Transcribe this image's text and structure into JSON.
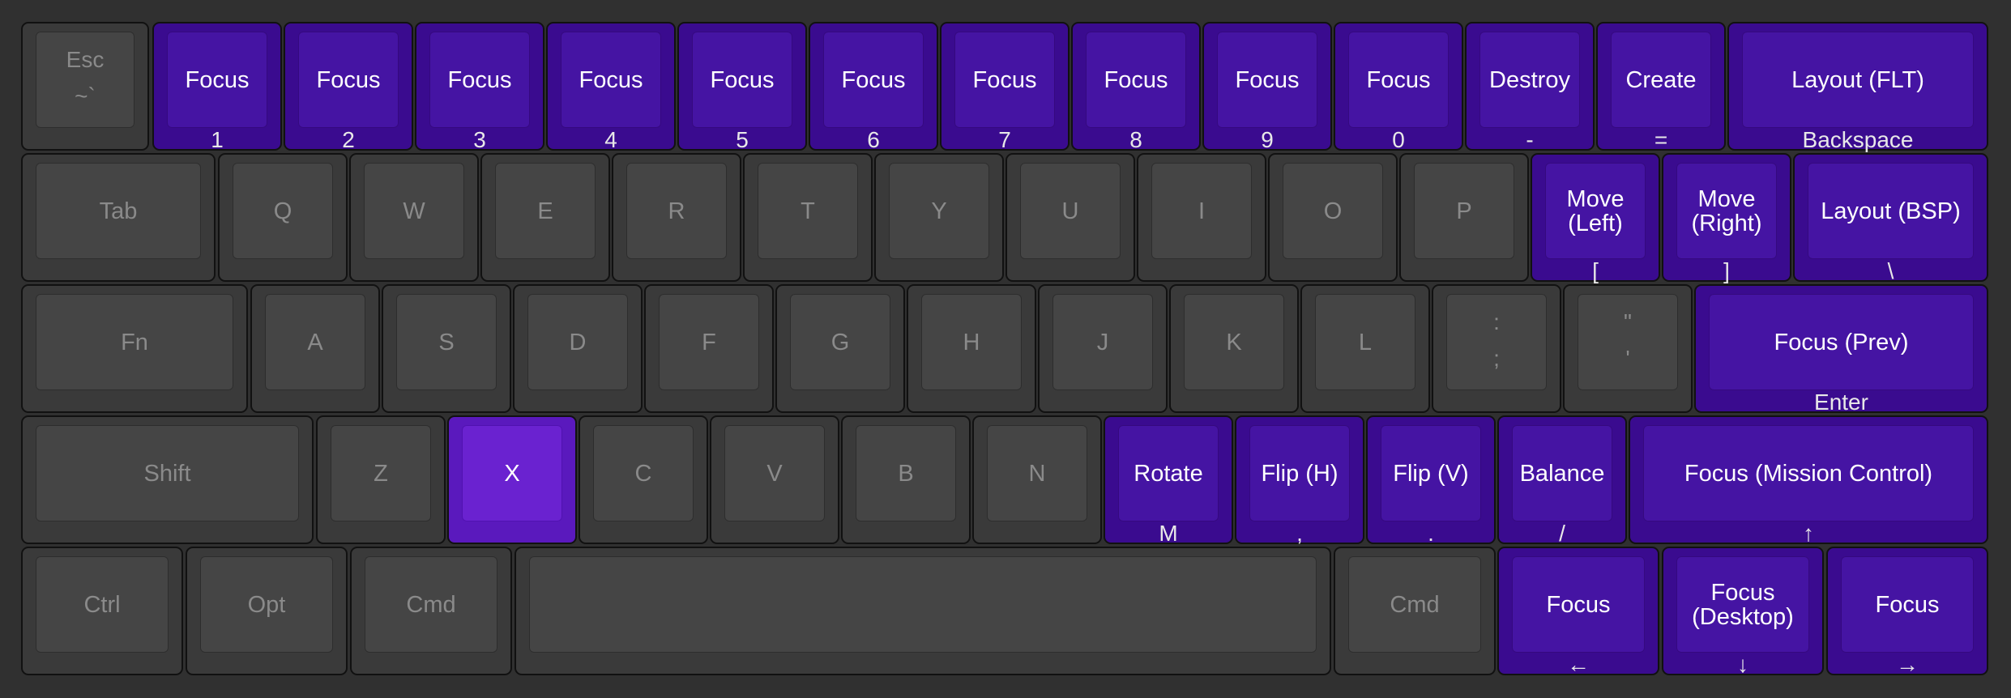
{
  "colors": {
    "background": "#303030",
    "key_inactive": "#3a3a3a",
    "key_active": "#3a0b8f",
    "key_pressed": "#5a19bd",
    "label_inactive": "#8a8a8a",
    "label_active": "#ffffff"
  },
  "keyboard": {
    "rows": [
      {
        "keys": [
          {
            "top": "Esc",
            "bottom": "~`",
            "active": false
          },
          {
            "label": "Focus",
            "sub": "1",
            "active": true
          },
          {
            "label": "Focus",
            "sub": "2",
            "active": true
          },
          {
            "label": "Focus",
            "sub": "3",
            "active": true
          },
          {
            "label": "Focus",
            "sub": "4",
            "active": true
          },
          {
            "label": "Focus",
            "sub": "5",
            "active": true
          },
          {
            "label": "Focus",
            "sub": "6",
            "active": true
          },
          {
            "label": "Focus",
            "sub": "7",
            "active": true
          },
          {
            "label": "Focus",
            "sub": "8",
            "active": true
          },
          {
            "label": "Focus",
            "sub": "9",
            "active": true
          },
          {
            "label": "Focus",
            "sub": "0",
            "active": true
          },
          {
            "label": "Destroy",
            "sub": "-",
            "active": true
          },
          {
            "label": "Create",
            "sub": "=",
            "active": true
          },
          {
            "label": "Layout (FLT)",
            "sub": "Backspace",
            "active": true
          }
        ]
      },
      {
        "keys": [
          {
            "label": "Tab",
            "active": false
          },
          {
            "label": "Q",
            "active": false
          },
          {
            "label": "W",
            "active": false
          },
          {
            "label": "E",
            "active": false
          },
          {
            "label": "R",
            "active": false
          },
          {
            "label": "T",
            "active": false
          },
          {
            "label": "Y",
            "active": false
          },
          {
            "label": "U",
            "active": false
          },
          {
            "label": "I",
            "active": false
          },
          {
            "label": "O",
            "active": false
          },
          {
            "label": "P",
            "active": false
          },
          {
            "label": "Move\n(Left)",
            "sub": "[",
            "active": true
          },
          {
            "label": "Move\n(Right)",
            "sub": "]",
            "active": true
          },
          {
            "label": "Layout (BSP)",
            "sub": "\\",
            "active": true
          }
        ]
      },
      {
        "keys": [
          {
            "label": "Fn",
            "active": false
          },
          {
            "label": "A",
            "active": false
          },
          {
            "label": "S",
            "active": false
          },
          {
            "label": "D",
            "active": false
          },
          {
            "label": "F",
            "active": false
          },
          {
            "label": "G",
            "active": false
          },
          {
            "label": "H",
            "active": false
          },
          {
            "label": "J",
            "active": false
          },
          {
            "label": "K",
            "active": false
          },
          {
            "label": "L",
            "active": false
          },
          {
            "top": ":",
            "bottom": ";",
            "active": false
          },
          {
            "top": "\"",
            "bottom": "'",
            "active": false
          },
          {
            "label": "Focus (Prev)",
            "sub": "Enter",
            "active": true
          }
        ]
      },
      {
        "keys": [
          {
            "label": "Shift",
            "active": false
          },
          {
            "label": "Z",
            "active": false
          },
          {
            "label": "X",
            "active": true,
            "pressed": true
          },
          {
            "label": "C",
            "active": false
          },
          {
            "label": "V",
            "active": false
          },
          {
            "label": "B",
            "active": false
          },
          {
            "label": "N",
            "active": false
          },
          {
            "label": "Rotate",
            "sub": "M",
            "active": true
          },
          {
            "label": "Flip (H)",
            "sub": ",",
            "active": true
          },
          {
            "label": "Flip (V)",
            "sub": ".",
            "active": true
          },
          {
            "label": "Balance",
            "sub": "/",
            "active": true
          },
          {
            "label": "Focus (Mission Control)",
            "sub": "↑",
            "active": true
          }
        ]
      },
      {
        "keys": [
          {
            "label": "Ctrl",
            "active": false
          },
          {
            "label": "Opt",
            "active": false
          },
          {
            "label": "Cmd",
            "active": false
          },
          {
            "label": "",
            "active": false
          },
          {
            "label": "Cmd",
            "active": false
          },
          {
            "label": "Focus",
            "sub": "←",
            "active": true
          },
          {
            "label": "Focus\n(Desktop)",
            "sub": "↓",
            "active": true
          },
          {
            "label": "Focus",
            "sub": "→",
            "active": true
          }
        ]
      }
    ]
  }
}
